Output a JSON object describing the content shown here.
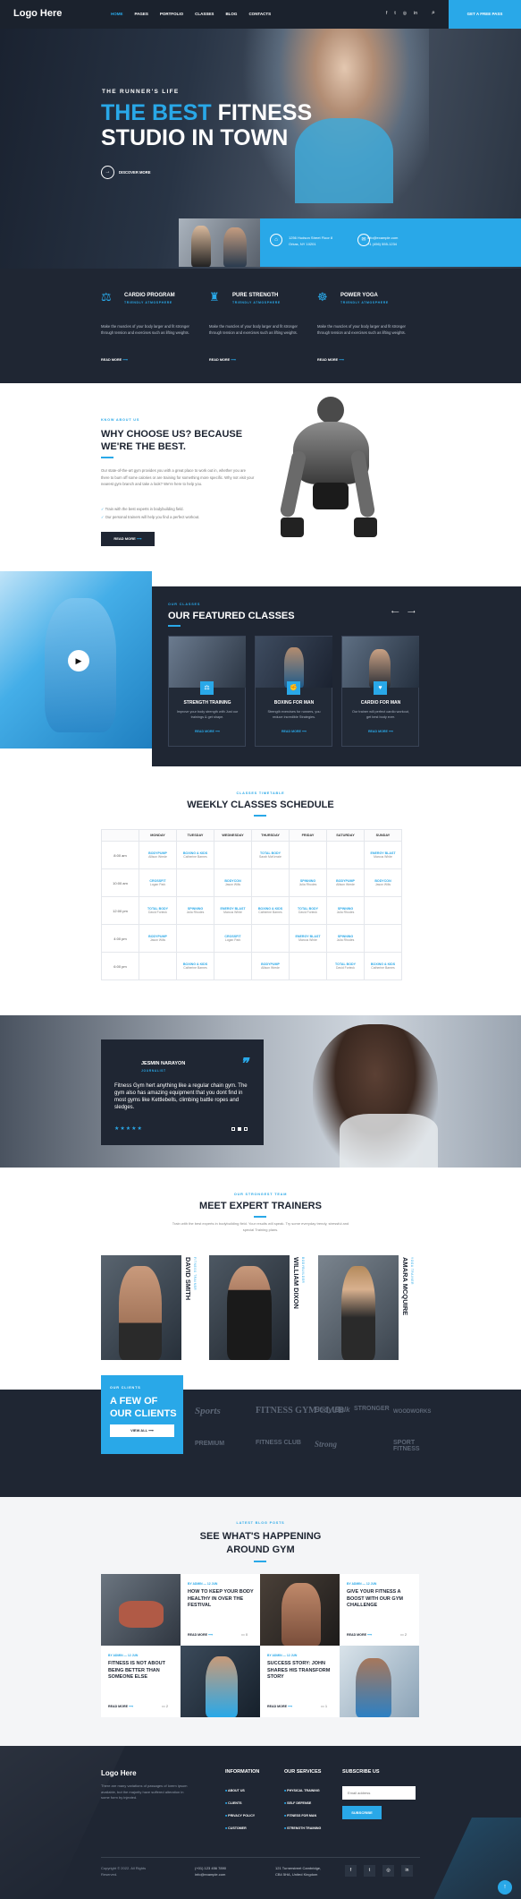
{
  "header": {
    "logo": "Logo Here",
    "nav": [
      "HOME",
      "PAGES",
      "PORTFOLIO",
      "CLASSES",
      "BLOG",
      "CONTACTS"
    ],
    "cta": "GET A FREE PASS",
    "social": [
      "facebook-icon",
      "twitter-icon",
      "instagram-icon",
      "linkedin-icon"
    ]
  },
  "hero": {
    "eyebrow": "THE RUNNER'S LIFE",
    "title_blue": "THE BEST",
    "title_white_1": "FITNESS",
    "title_white_2": "STUDIO IN TOWN",
    "discover": "DISCOVER MORE",
    "address_1": "1256 Hudson Street Floor 8",
    "address_2": "Orkas, NY 10201",
    "email": "info@example.com",
    "phone": "+1 (456) 555-1234"
  },
  "services": [
    {
      "title": "CARDIO PROGRAM",
      "sub": "TRIENDLY ATMOSPHERE",
      "text": "Make the muscles of your body larger and fit stronger through tension and exercises such as lifting weights.",
      "more": "READ MORE"
    },
    {
      "title": "PURE STRENGTH",
      "sub": "TRIENDLY ATMOSPHERE",
      "text": "Make the muscles of your body larger and fit stronger through tension and exercises such as lifting weights.",
      "more": "READ MORE"
    },
    {
      "title": "POWER YOGA",
      "sub": "TRIENDLY ATMOSPHERE",
      "text": "Make the muscles of your body larger and fit stronger through tension and exercises such as lifting weights.",
      "more": "READ MORE"
    }
  ],
  "why": {
    "eyebrow": "KNOW ABOUT US",
    "title_1": "WHY CHOOSE US? BECAUSE",
    "title_2": "WE'RE THE BEST.",
    "text": "Our state-of-the-art gym provides you with a great place to work out in, whether you are there to burn off some calories or are training for something more specific. Why not visit your nearest gym branch and take a look? We're here to help you.",
    "bullets": [
      "Train with the best experts in bodybuilding field.",
      "Our personal trainers will help you find a perfect workout."
    ],
    "button": "READ MORE"
  },
  "featured": {
    "eyebrow": "OUR CLASSES",
    "title": "OUR FEATURED CLASSES",
    "classes": [
      {
        "title": "STRENGTH TRAINING",
        "text": "Improve your body strength with Just our trainings & get shape.",
        "more": "READ MORE"
      },
      {
        "title": "BOXING FOR MAN",
        "text": "Strength exercises for runners, you reduce incredible Strategies.",
        "more": "READ MORE"
      },
      {
        "title": "CARDIO FOR MAN",
        "text": "Our trainer will perfect cardio workout, get best body ever.",
        "more": "READ MORE"
      }
    ]
  },
  "schedule": {
    "eyebrow": "CLASSES TIMETABLE",
    "title": "WEEKLY CLASSES SCHEDULE",
    "days": [
      "MONDAY",
      "TUESDAY",
      "WEDNESDAY",
      "THURSDAY",
      "FRIDAY",
      "SATURDAY",
      "SUNDAY"
    ],
    "rows": [
      {
        "time": "8:00 am",
        "cells": [
          [
            "BODYPUMP",
            "Allison Wrede"
          ],
          [
            "BOXING & KIDS",
            "Catherine Barnes"
          ],
          [
            "",
            ""
          ],
          [
            "TOTAL BODY",
            "Sarah McKenzie"
          ],
          [
            "",
            ""
          ],
          [
            "",
            ""
          ],
          [
            "ENERGY BLAST",
            "Marcus White"
          ]
        ]
      },
      {
        "time": "10:00 am",
        "cells": [
          [
            "CROSSFIT",
            "Logan Park"
          ],
          [
            "",
            ""
          ],
          [
            "BODYCON",
            "Jason Wills"
          ],
          [
            "",
            ""
          ],
          [
            "SPINNING",
            "Julia Rhodes"
          ],
          [
            "BODYPUMP",
            "Allison Wrede"
          ],
          [
            "BODYCON",
            "Jason Wills"
          ]
        ]
      },
      {
        "time": "12:00 pm",
        "cells": [
          [
            "TOTAL BODY",
            "David Forteck"
          ],
          [
            "SPINNING",
            "Julia Rhodes"
          ],
          [
            "ENERGY BLAST",
            "Marcus White"
          ],
          [
            "BOXING & KIDS",
            "Catherine Barnes"
          ],
          [
            "TOTAL BODY",
            "David Forteck"
          ],
          [
            "SPINNING",
            "Julia Rhodes"
          ],
          [
            "",
            ""
          ]
        ]
      },
      {
        "time": "4:00 pm",
        "cells": [
          [
            "BODYPUMP",
            "Jason Wills"
          ],
          [
            "",
            ""
          ],
          [
            "CROSSFIT",
            "Logan Park"
          ],
          [
            "",
            ""
          ],
          [
            "ENERGY BLAST",
            "Marcus White"
          ],
          [
            "SPINNING",
            "Julia Rhodes"
          ],
          [
            "",
            ""
          ]
        ]
      },
      {
        "time": "6:00 pm",
        "cells": [
          [
            "",
            ""
          ],
          [
            "BOXING & KIDS",
            "Catherine Barnes"
          ],
          [
            "",
            ""
          ],
          [
            "BODYPUMP",
            "Allison Wrede"
          ],
          [
            "",
            ""
          ],
          [
            "TOTAL BODY",
            "David Forteck"
          ],
          [
            "BOXING & KIDS",
            "Catherine Barnes"
          ]
        ]
      }
    ]
  },
  "testimonial": {
    "name": "JESMIN NARAYON",
    "role": "JOURNALIST",
    "quote": "Fitness Gym hert anything like a regular chain gym. The gym also has amazing equipment that you dont find in most gyms like Kettlebells, climbing battle ropes and sledges.",
    "stars": "★★★★★"
  },
  "trainers": {
    "eyebrow": "OUR STRONGEST TEAM",
    "title": "MEET EXPERT TRAINERS",
    "text": "Train with the best experts in bodybuilding field. Your results will speak. Try some everyday trendy, stressful and special Training plans.",
    "list": [
      {
        "name": "DAVID SMITH",
        "role": "FITNESS TRAINER"
      },
      {
        "name": "WILLIAM DIXON",
        "role": "BODYBUILDER"
      },
      {
        "name": "AMARA MCQUIRE",
        "role": "YOGA TRAINER"
      }
    ]
  },
  "clients": {
    "eyebrow": "OUR CLIENTS",
    "title_1": "A FEW OF",
    "title_2": "OUR CLIENTS",
    "button": "VIEW ALL",
    "logos": [
      "Sports",
      "FITNESS GYM CLUB",
      "Body Bulk",
      "STRONGER",
      "WOODWORKS",
      "PREMIUM",
      "FITNESS CLUB",
      "Strong",
      "SPORT FITNESS"
    ]
  },
  "blog": {
    "eyebrow": "LATEST BLOG POSTS",
    "title_1": "SEE WHAT'S HAPPENING",
    "title_2": "AROUND GYM",
    "posts": [
      {
        "meta": "BY ADMIN — 12 JUN",
        "title": "HOW TO KEEP YOUR BODY HEALTHY IN OVER THE FESTIVAL",
        "more": "READ MORE",
        "comments": "0"
      },
      {
        "meta": "BY ADMIN — 12 JUN",
        "title": "GIVE YOUR FITNESS A BOOST WITH OUR GYM CHALLENGE",
        "more": "READ MORE",
        "comments": "2"
      },
      {
        "meta": "BY ADMIN — 12 JUN",
        "title": "FITNESS IS NOT ABOUT BEING BETTER THAN SOMEONE ELSE",
        "more": "READ MORE",
        "comments": "2"
      },
      {
        "meta": "BY ADMIN — 12 JUN",
        "title": "SUCCESS STORY: JOHN SHARES HIS TRANSFORM STORY",
        "more": "READ MORE",
        "comments": "1"
      }
    ]
  },
  "footer": {
    "logo": "Logo Here",
    "about": "There are many variations of passages of lorem ipsum available, but the majority have suffered alteration in some form by injected.",
    "info_title": "INFORMATION",
    "info": [
      "ABOUT US",
      "CLIENTS",
      "PRIVACY POLICY",
      "CUSTOMER"
    ],
    "services_title": "OUR SERVICES",
    "services": [
      "PHYSICAL TRAINING",
      "SELF DEFENSE",
      "FITNESS FOR MAN",
      "STRENGTH TRAINING"
    ],
    "subscribe_title": "SUBSCRIBE US",
    "email_placeholder": "Email address",
    "subscribe_btn": "SUBSCRIBE",
    "copyright_1": "Copyright © 2022. All Rights",
    "copyright_2": "Reserved.",
    "phone": "(+01) 123 456 7890",
    "email": "info@example.com",
    "address_1": "121 Turnerstreet Cambridge,",
    "address_2": "CB4 5HA, United Kingdom",
    "colors": {
      "accent": "#29a8e8",
      "dark": "#1f2633"
    }
  }
}
